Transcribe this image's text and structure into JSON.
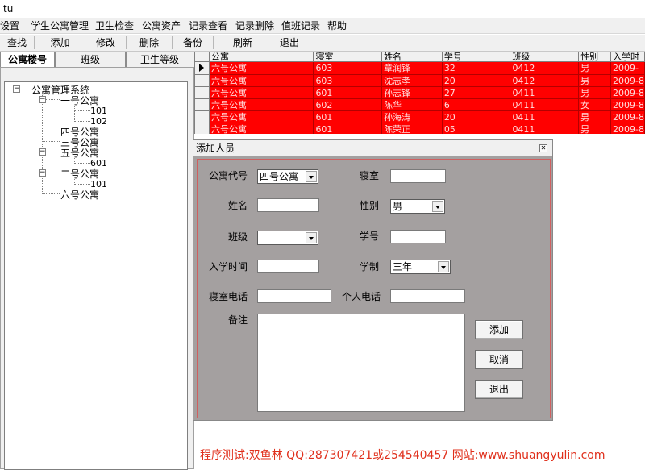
{
  "window": {
    "title": "tu"
  },
  "menu": [
    "统设置",
    "学生公寓管理",
    "卫生检查",
    "公寓资产",
    "记录查看",
    "记录删除",
    "值班记录",
    "帮助"
  ],
  "toolbar": [
    "查找",
    "添加",
    "修改",
    "删除",
    "备份",
    "刷新",
    "退出"
  ],
  "tabs": [
    "公寓楼号",
    "班级",
    "卫生等级"
  ],
  "tree": {
    "root": "公寓管理系统",
    "nodes": [
      "一号公寓",
      "101",
      "102",
      "四号公寓",
      "三号公寓",
      "五号公寓",
      "601",
      "二号公寓",
      "101",
      "六号公寓"
    ]
  },
  "grid": {
    "headers": [
      "公寓",
      "寝室",
      "姓名",
      "学号",
      "班级",
      "性别",
      "入学时"
    ],
    "rows": [
      [
        "六号公寓",
        "603",
        "章润锋",
        "32",
        "0412",
        "男",
        "2009-"
      ],
      [
        "六号公寓",
        "603",
        "沈志孝",
        "20",
        "0412",
        "男",
        "2009-8"
      ],
      [
        "六号公寓",
        "601",
        "孙志锋",
        "27",
        "0411",
        "男",
        "2009-8"
      ],
      [
        "六号公寓",
        "602",
        "陈华",
        "6",
        "0411",
        "女",
        "2009-8"
      ],
      [
        "六号公寓",
        "601",
        "孙海涛",
        "20",
        "0411",
        "男",
        "2009-8"
      ],
      [
        "六号公寓",
        "601",
        "陈荣正",
        "05",
        "0411",
        "男",
        "2009-8"
      ]
    ],
    "selected_row": 0,
    "colors": {
      "row_bg": "#ff0000"
    }
  },
  "dialog": {
    "title": "添加人员",
    "labels": {
      "apt_code": "公寓代号",
      "room": "寝室",
      "name": "姓名",
      "gender": "性别",
      "class": "班级",
      "student_no": "学号",
      "enroll_date": "入学时间",
      "school_system": "学制",
      "room_phone": "寝室电话",
      "personal_phone": "个人电话",
      "remarks": "备注"
    },
    "values": {
      "apt_code": "四号公寓",
      "gender": "男",
      "school_system": "三年"
    },
    "buttons": {
      "add": "添加",
      "cancel": "取消",
      "exit": "退出"
    }
  },
  "footer": "程序测试:双鱼林 QQ:287307421或254540457 网站:www.shuangyulin.com"
}
